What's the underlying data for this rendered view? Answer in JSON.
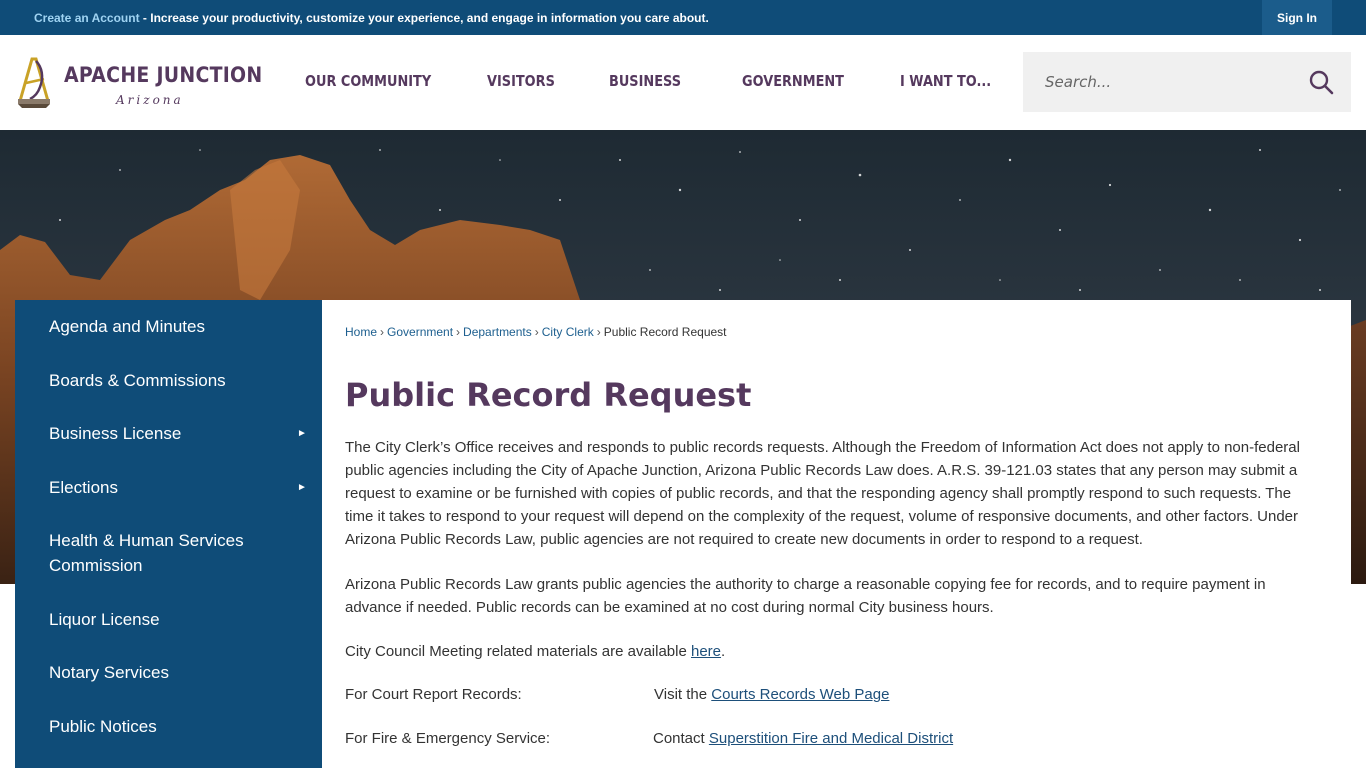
{
  "topbar": {
    "create_account_link": "Create an Account",
    "message": " - Increase your productivity, customize your experience, and engage in information you care about.",
    "sign_in": "Sign In"
  },
  "logo": {
    "title": "APACHE JUNCTION",
    "subtitle": "Arizona"
  },
  "nav": {
    "items": [
      "OUR COMMUNITY",
      "VISITORS",
      "BUSINESS",
      "GOVERNMENT",
      "I WANT TO..."
    ]
  },
  "search": {
    "placeholder": "Search..."
  },
  "sidebar": {
    "items": [
      {
        "label": "Agenda and Minutes",
        "has_submenu": false
      },
      {
        "label": "Boards & Commissions",
        "has_submenu": false
      },
      {
        "label": "Business License",
        "has_submenu": true
      },
      {
        "label": "Elections",
        "has_submenu": true
      },
      {
        "label": "Health & Human Services Commission",
        "has_submenu": false
      },
      {
        "label": "Liquor License",
        "has_submenu": false
      },
      {
        "label": "Notary Services",
        "has_submenu": false
      },
      {
        "label": "Public Notices",
        "has_submenu": false
      }
    ],
    "arrow_glyph": "►"
  },
  "breadcrumb": {
    "home": "Home",
    "government": "Government",
    "departments": "Departments",
    "city_clerk": "City Clerk",
    "current": "Public Record Request",
    "separator": "›"
  },
  "main": {
    "title": "Public Record Request",
    "paragraph1": "The City Clerk’s Office receives and responds to public records requests. Although the Freedom of Information Act does not apply to non-federal public agencies including the City of Apache Junction, Arizona Public Records Law does. A.R.S. 39-121.03 states that any person may submit a request to examine or be furnished with copies of public records, and that the responding agency shall promptly respond to such requests. The time it takes to respond to your request will depend on the complexity of the request, volume of responsive documents, and other factors. Under Arizona Public Records Law, public agencies are not required to create new documents in order to respond to a request.",
    "paragraph2": "Arizona Public Records Law grants public agencies the authority to charge a reasonable copying fee for records, and to require payment in advance if needed. Public records can be examined at no cost during normal City business hours.",
    "council_text": "City Council Meeting related materials are available ",
    "council_link": "here",
    "council_end": ".",
    "rows": [
      {
        "label": "For Court Report Records:",
        "prefix": "Visit the ",
        "link": "Courts Records Web Page"
      },
      {
        "label": "For Fire & Emergency Service:",
        "prefix": "Contact ",
        "link": "Superstition Fire and Medical District"
      }
    ]
  },
  "colors": {
    "brand_blue": "#0f4c78",
    "brand_purple": "#55395e",
    "link_blue": "#1d5f8f"
  }
}
